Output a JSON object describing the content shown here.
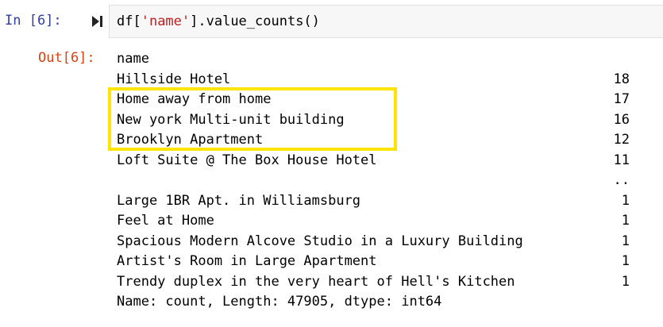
{
  "cell": {
    "in_prompt": "In [6]:",
    "code_prefix": "df[",
    "code_string": "'name'",
    "code_suffix": "].value_counts()",
    "out_prompt": "Out[6]:"
  },
  "output": {
    "header": "name",
    "rows": [
      {
        "label": "Hillside Hotel",
        "count": "18"
      },
      {
        "label": "Home away from home",
        "count": "17"
      },
      {
        "label": "New york Multi-unit building",
        "count": "16"
      },
      {
        "label": "Brooklyn Apartment",
        "count": "12"
      },
      {
        "label": "Loft Suite @ The Box House Hotel",
        "count": "11"
      },
      {
        "label": "",
        "count": ".."
      },
      {
        "label": "Large 1BR Apt. in Williamsburg",
        "count": "1"
      },
      {
        "label": "Feel at Home",
        "count": "1"
      },
      {
        "label": "Spacious Modern Alcove Studio in a Luxury Building",
        "count": "1"
      },
      {
        "label": "Artist's Room in Large Apartment",
        "count": "1"
      },
      {
        "label": "Trendy duplex in the very heart of Hell's Kitchen",
        "count": "1"
      }
    ],
    "footer": "Name: count, Length: 47905, dtype: int64"
  },
  "colors": {
    "in_prompt": "#303f9f",
    "out_prompt": "#d84315",
    "string": "#ba2121",
    "highlight": "#ffe400"
  }
}
